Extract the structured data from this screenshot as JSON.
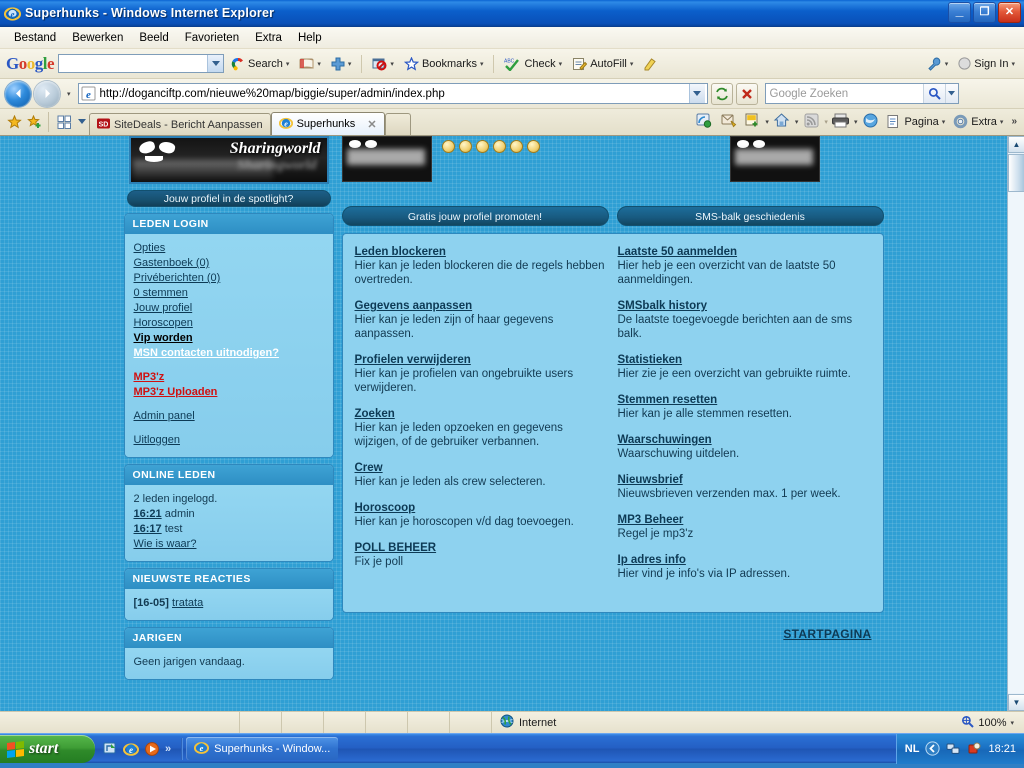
{
  "window": {
    "title": "Superhunks - Windows Internet Explorer",
    "minimize_label": "_",
    "maximize_label": "❐",
    "close_label": "✕"
  },
  "menubar": {
    "items": [
      "Bestand",
      "Bewerken",
      "Beeld",
      "Favorieten",
      "Extra",
      "Help"
    ]
  },
  "google_toolbar": {
    "logo": "Google",
    "search_value": "",
    "search_label": "Search",
    "bookmarks_label": "Bookmarks",
    "check_label": "Check",
    "autofill_label": "AutoFill",
    "signin_label": "Sign In"
  },
  "address_bar": {
    "url": "http://doganciftp.com/nieuwe%20map/biggie/super/admin/index.php",
    "search_placeholder": "Google Zoeken",
    "refresh_label": "↻",
    "stop_label": "✕"
  },
  "tabs": {
    "items": [
      {
        "label": "SiteDeals - Bericht Aanpassen",
        "active": false
      },
      {
        "label": "Superhunks",
        "active": true
      }
    ],
    "close_label": "✕"
  },
  "command_bar": {
    "page_label": "Pagina",
    "tools_label": "Extra",
    "overflow_label": "»"
  },
  "page": {
    "sidebar": {
      "banner_text": "Sharingworld",
      "spotlight_label": "Jouw profiel in de spotlight?",
      "boxes": [
        {
          "title": "LEDEN LOGIN",
          "links": [
            {
              "text": "Opties",
              "style": "plain"
            },
            {
              "text": "Gastenboek (0)",
              "style": "plain"
            },
            {
              "text": "Privéberichten (0)",
              "style": "plain"
            },
            {
              "text": "0 stemmen",
              "style": "plain"
            },
            {
              "text": "Jouw profiel",
              "style": "plain"
            },
            {
              "text": "Horoscopen",
              "style": "plain"
            },
            {
              "text": "Vip worden",
              "style": "bold"
            },
            {
              "text": "MSN contacten uitnodigen?",
              "style": "white"
            },
            {
              "text": "",
              "style": "spacer"
            },
            {
              "text": "MP3'z",
              "style": "red"
            },
            {
              "text": "MP3'z Uploaden",
              "style": "red"
            },
            {
              "text": "",
              "style": "spacer"
            },
            {
              "text": "Admin panel",
              "style": "plain"
            },
            {
              "text": "",
              "style": "spacer"
            },
            {
              "text": "Uitloggen",
              "style": "plain"
            }
          ]
        }
      ],
      "online": {
        "title": "ONLINE LEDEN",
        "count_text": "2 leden ingelogd.",
        "members": [
          {
            "time": "16:21",
            "name": "admin"
          },
          {
            "time": "16:17",
            "name": "test"
          }
        ],
        "who_link": "Wie is waar?"
      },
      "reactions": {
        "title": "NIEUWSTE REACTIES",
        "date": "[16-05]",
        "link": "tratata"
      },
      "birthdays": {
        "title": "JARIGEN",
        "text": "Geen jarigen vandaag."
      }
    },
    "main": {
      "buttons": [
        "Gratis jouw profiel promoten!",
        "SMS-balk geschiedenis"
      ],
      "left_items": [
        {
          "title": "Leden blockeren",
          "desc": "Hier kan je leden blockeren die de regels hebben overtreden."
        },
        {
          "title": "Gegevens aanpassen",
          "desc": "Hier kan je leden zijn of haar gegevens aanpassen."
        },
        {
          "title": "Profielen verwijderen",
          "desc": "Hier kan je profielen van ongebruikte users verwijderen."
        },
        {
          "title": "Zoeken",
          "desc": "Hier kan je leden opzoeken en gegevens wijzigen, of de gebruiker verbannen."
        },
        {
          "title": "Crew",
          "desc": "Hier kan je leden als crew selecteren."
        },
        {
          "title": "Horoscoop",
          "desc": "Hier kan je horoscopen v/d dag toevoegen."
        },
        {
          "title": "POLL BEHEER",
          "desc": "Fix je poll"
        }
      ],
      "right_items": [
        {
          "title": "Laatste 50 aanmelden",
          "desc": "Hier heb je een overzicht van de laatste 50 aanmeldingen."
        },
        {
          "title": "SMSbalk history",
          "desc": "De laatste toegevoegde berichten aan de sms balk."
        },
        {
          "title": "Statistieken",
          "desc": "Hier zie je een overzicht van gebruikte ruimte."
        },
        {
          "title": "Stemmen resetten",
          "desc": "Hier kan je alle stemmen resetten."
        },
        {
          "title": "Waarschuwingen",
          "desc": "Waarschuwing uitdelen."
        },
        {
          "title": "Nieuwsbrief",
          "desc": "Nieuwsbrieven verzenden max. 1 per week."
        },
        {
          "title": "MP3 Beheer",
          "desc": "Regel je mp3'z"
        },
        {
          "title": "Ip adres info",
          "desc": "Hier vind je info's via IP adressen."
        }
      ],
      "start_link": "STARTPAGINA"
    }
  },
  "status_bar": {
    "zone": "Internet",
    "zoom": "100%",
    "zoom_caret": "▾"
  },
  "taskbar": {
    "start_label": "start",
    "overflow_label": "»",
    "task_label": "Superhunks - Window...",
    "language": "NL",
    "clock": "18:21"
  },
  "colors": {
    "title_blue": "#0b5fcb",
    "page_blue": "#2f9fd4",
    "panel_blue": "#8ed2ef",
    "link_navy": "#0d3a55",
    "red_link": "#d01010",
    "taskbar_blue": "#245fc4",
    "start_green": "#3f9e36"
  }
}
